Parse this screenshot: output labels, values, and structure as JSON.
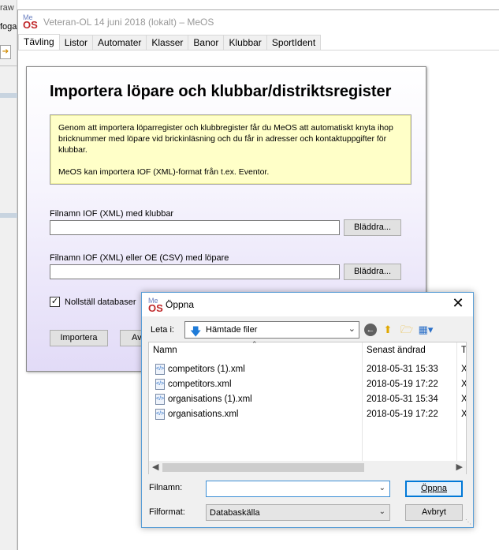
{
  "background_app": {
    "text_top": "raw",
    "text_second": "foga"
  },
  "window": {
    "title": "Veteran-OL 14 juni 2018 (lokalt) – MeOS",
    "icon_top": "Me",
    "icon_bottom": "OS"
  },
  "tabs": [
    {
      "label": "Tävling"
    },
    {
      "label": "Listor"
    },
    {
      "label": "Automater"
    },
    {
      "label": "Klasser"
    },
    {
      "label": "Banor"
    },
    {
      "label": "Klubbar"
    },
    {
      "label": "SportIdent"
    }
  ],
  "import_panel": {
    "heading": "Importera löpare och klubbar/distriktsregister",
    "info_p1": "Genom att importera löparregister och klubbregister får du MeOS att automatiskt knyta ihop bricknummer med löpare vid brickinläsning och du får in adresser och kontaktuppgifter för klubbar.",
    "info_p2": "MeOS kan importera IOF (XML)-format från t.ex. Eventor.",
    "clubs_label": "Filnamn IOF (XML) med klubbar",
    "clubs_value": "",
    "runners_label": "Filnamn IOF (XML) eller OE (CSV) med löpare",
    "runners_value": "",
    "browse_label": "Bläddra...",
    "reset_checkbox_label": "Nollställ databaser",
    "reset_checked": "✓",
    "import_button": "Importera",
    "second_button_partial": "Av"
  },
  "open_dialog": {
    "title": "Öppna",
    "close": "✕",
    "look_in_label": "Leta i:",
    "look_in_value": "Hämtade filer",
    "columns": {
      "name": "Namn",
      "modified": "Senast ändrad",
      "type": "Ty"
    },
    "files": [
      {
        "name": "competitors (1).xml",
        "modified": "2018-05-31 15:33",
        "type": "XI"
      },
      {
        "name": "competitors.xml",
        "modified": "2018-05-19 17:22",
        "type": "XI"
      },
      {
        "name": "organisations (1).xml",
        "modified": "2018-05-31 15:34",
        "type": "XI"
      },
      {
        "name": "organisations.xml",
        "modified": "2018-05-19 17:22",
        "type": "XI"
      }
    ],
    "filename_label": "Filnamn:",
    "filename_value": "",
    "filetype_label": "Filformat:",
    "filetype_value": "Databaskälla",
    "open_button": "Öppna",
    "cancel_button": "Avbryt"
  }
}
